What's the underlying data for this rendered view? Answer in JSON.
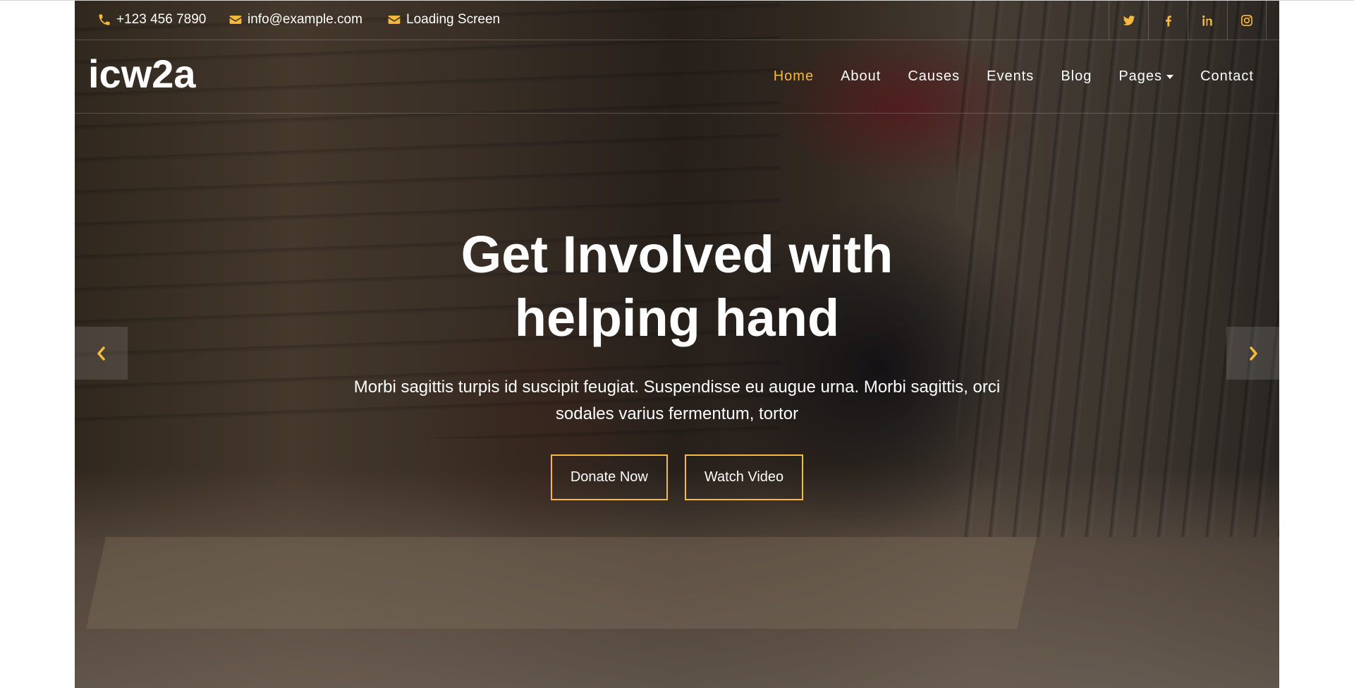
{
  "topbar": {
    "phone": "+123 456 7890",
    "email": "info@example.com",
    "loading": "Loading Screen",
    "social": [
      "twitter-icon",
      "facebook-icon",
      "linkedin-icon",
      "instagram-icon"
    ]
  },
  "navbar": {
    "brand": "icw2a",
    "links": [
      {
        "label": "Home",
        "active": true
      },
      {
        "label": "About"
      },
      {
        "label": "Causes"
      },
      {
        "label": "Events"
      },
      {
        "label": "Blog"
      },
      {
        "label": "Pages",
        "dropdown": true
      },
      {
        "label": "Contact"
      }
    ]
  },
  "hero": {
    "title_line1": "Get Involved with",
    "title_line2": "helping hand",
    "text": "Morbi sagittis turpis id suscipit feugiat. Suspendisse eu augue urna. Morbi sagittis, orci sodales varius fermentum, tortor",
    "donate_label": "Donate Now",
    "video_label": "Watch Video"
  },
  "colors": {
    "accent": "#f6b93b",
    "text": "#ffffff"
  }
}
